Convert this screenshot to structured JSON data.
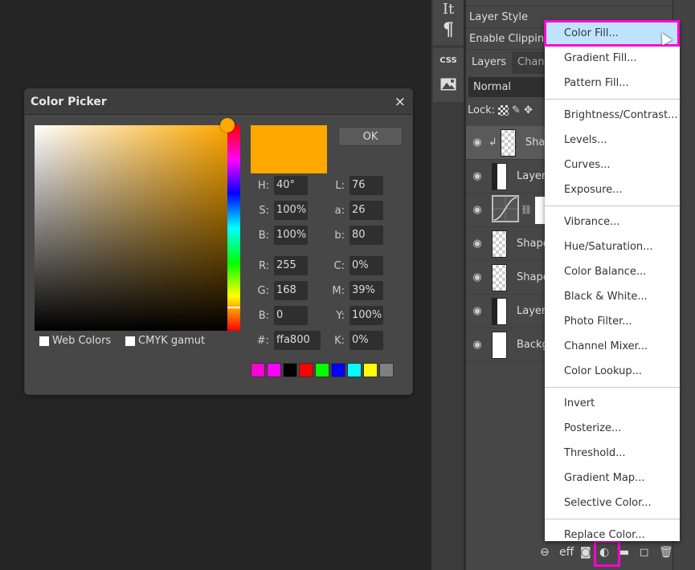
{
  "color_picker": {
    "title": "Color Picker",
    "close_glyph": "×",
    "ok_label": "OK",
    "current_color": "#ffa800",
    "fields_left": [
      {
        "label": "H:",
        "value": "40°"
      },
      {
        "label": "S:",
        "value": "100%"
      },
      {
        "label": "B:",
        "value": "100%"
      },
      {
        "label": "R:",
        "value": "255"
      },
      {
        "label": "G:",
        "value": "168"
      },
      {
        "label": "B:",
        "value": "0"
      },
      {
        "label": "#:",
        "value": "ffa800"
      }
    ],
    "fields_right": [
      {
        "label": "L:",
        "value": "76"
      },
      {
        "label": "a:",
        "value": "26"
      },
      {
        "label": "b:",
        "value": "80"
      },
      {
        "label": "C:",
        "value": "0%"
      },
      {
        "label": "M:",
        "value": "39%"
      },
      {
        "label": "Y:",
        "value": "100%"
      },
      {
        "label": "K:",
        "value": "0%"
      }
    ],
    "web_colors_label": "Web Colors",
    "cmyk_gamut_label": "CMYK gamut",
    "swatches": [
      "#ff00d4",
      "#ff00ff",
      "#000000",
      "#ff0000",
      "#00ff00",
      "#0000ff",
      "#00ffff",
      "#ffff00",
      "#808080"
    ]
  },
  "side_tools": [
    "type-tool",
    "paragraph-tool",
    "css-tool",
    "image-tool"
  ],
  "side_tool_glyphs": {
    "type": "It",
    "paragraph": "¶",
    "css": "CSS"
  },
  "layer_menu": {
    "rows": [
      "Layer Style",
      "Enable Clipping"
    ]
  },
  "layers_panel": {
    "tabs": [
      "Layers",
      "Chann"
    ],
    "blend_mode": "Normal",
    "lock_label": "Lock:",
    "layers": [
      {
        "name": "Shap",
        "type": "shape",
        "selected": true
      },
      {
        "name": "Layer",
        "type": "raster"
      },
      {
        "name": "",
        "type": "curves-adjustment"
      },
      {
        "name": "Shape",
        "type": "shape"
      },
      {
        "name": "Shape",
        "type": "shape"
      },
      {
        "name": "Layer",
        "type": "raster"
      },
      {
        "name": "Backg",
        "type": "background"
      }
    ],
    "bottom_icons": [
      "link",
      "eff",
      "mask",
      "adjustment",
      "folder",
      "new-layer",
      "trash"
    ],
    "effects_label": "eff"
  },
  "adjustment_menu": {
    "groups": [
      [
        "Color Fill...",
        "Gradient Fill...",
        "Pattern Fill..."
      ],
      [
        "Brightness/Contrast...",
        "Levels...",
        "Curves...",
        "Exposure..."
      ],
      [
        "Vibrance...",
        "Hue/Saturation...",
        "Color Balance...",
        "Black & White...",
        "Photo Filter...",
        "Channel Mixer...",
        "Color Lookup..."
      ],
      [
        "Invert",
        "Posterize...",
        "Threshold...",
        "Gradient Map...",
        "Selective Color..."
      ],
      [
        "Replace Color..."
      ]
    ],
    "hovered": "Color Fill..."
  },
  "highlight_color": "#ff00d4"
}
